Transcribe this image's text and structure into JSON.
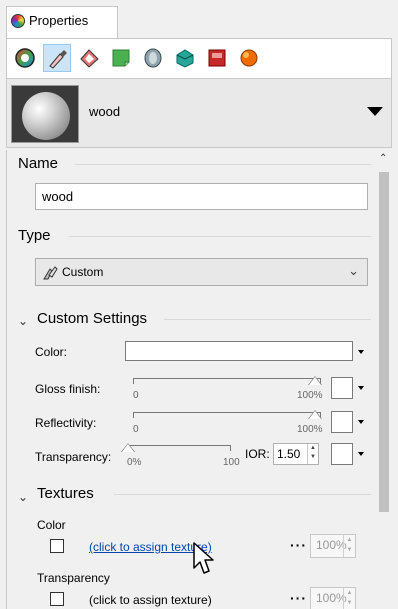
{
  "tab": {
    "label": "Properties"
  },
  "toolbar": {
    "icons": [
      "color-wheel-icon",
      "material-brush-icon",
      "texture-mapping-icon",
      "layer-icon",
      "decal-icon",
      "environment-icon",
      "sun-icon",
      "camera-icon"
    ]
  },
  "material": {
    "name": "wood"
  },
  "sections": {
    "name": {
      "title": "Name",
      "value": "wood"
    },
    "type": {
      "title": "Type",
      "selected": "Custom"
    },
    "custom": {
      "title": "Custom Settings",
      "color_label": "Color:",
      "gloss_label": "Gloss finish:",
      "gloss_min": "0",
      "gloss_max": "100%",
      "gloss_value": 1.0,
      "reflectivity_label": "Reflectivity:",
      "reflectivity_min": "0",
      "reflectivity_max": "100%",
      "reflectivity_value": 1.0,
      "transparency_label": "Transparency:",
      "transparency_min": "0%",
      "transparency_max": "100",
      "transparency_value": 0.0,
      "ior_label": "IOR:",
      "ior_value": "1.50"
    },
    "textures": {
      "title": "Textures",
      "items": [
        {
          "label": "Color",
          "link": "(click to assign texture)",
          "dots": "···",
          "amount": "100%"
        },
        {
          "label": "Transparency",
          "link": "(click to assign texture)",
          "dots": "···",
          "amount": "100%"
        }
      ]
    }
  },
  "colors": {
    "accent": "#0645ad",
    "selected_bg": "#cce4f7"
  }
}
